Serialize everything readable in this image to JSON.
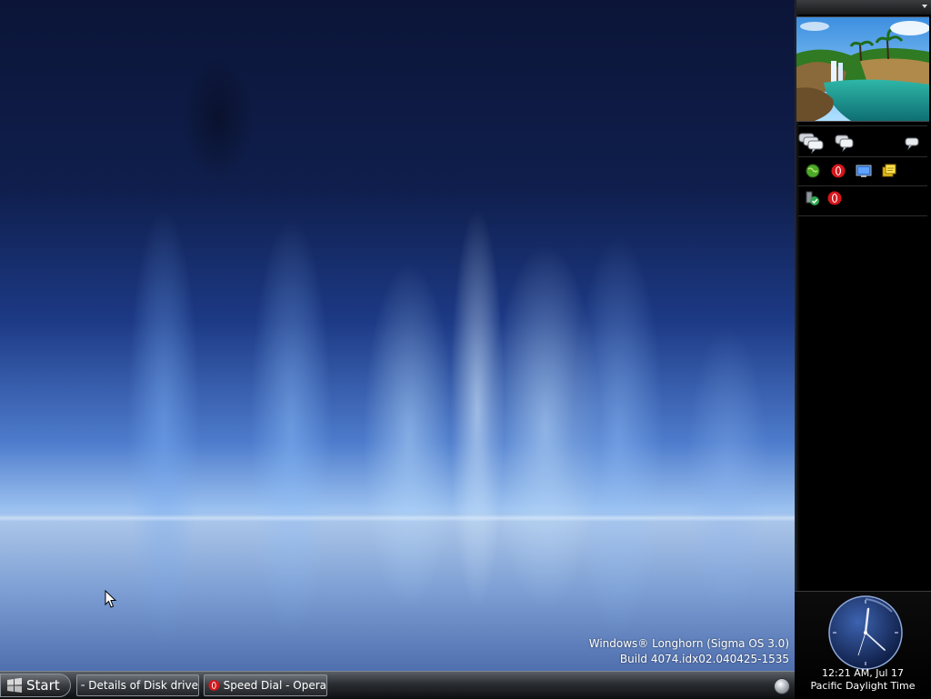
{
  "desktop": {
    "watermark_line1": "Windows® Longhorn (Sigma OS 3.0)",
    "watermark_line2": "Build 4074.idx02.040425-1535"
  },
  "taskbar": {
    "start_label": "Start",
    "tasks": [
      {
        "label": "Details of Disk drive",
        "icon": "disk-details-icon"
      },
      {
        "label": "Speed Dial - Opera",
        "icon": "opera-icon"
      }
    ],
    "tray_icon": "notification-orb-icon"
  },
  "sidebar": {
    "slideshow_icon": "waterfall-photo",
    "row1_icons": [
      "contacts-stack-icon",
      "messages-icon",
      "chat-bubble-icon"
    ],
    "row2_icons": [
      "green-globe-icon",
      "opera-icon",
      "monitor-icon",
      "sticky-notes-icon"
    ],
    "row3_icons": [
      "security-check-icon",
      "opera-icon"
    ],
    "clock": {
      "time": "12:21 AM, Jul 17",
      "zone": "Pacific Daylight Time"
    }
  },
  "colors": {
    "taskbar_dark": "#0d0e10",
    "sidebar_bg": "#000000",
    "opera_red": "#d4161c",
    "clock_face": "#1b3570"
  }
}
